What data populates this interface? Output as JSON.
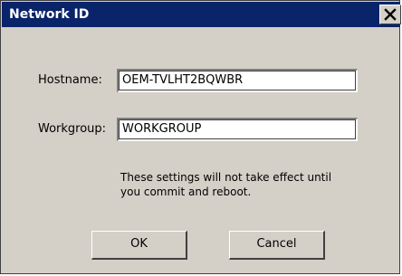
{
  "window": {
    "title": "Network ID",
    "title_bar_color": "#0a246a",
    "face_color": "#d4d0c8",
    "close_icon": "close-icon"
  },
  "form": {
    "hostname_label": "Hostname:",
    "hostname_value": "OEM-TVLHT2BQWBR",
    "workgroup_label": "Workgroup:",
    "workgroup_value": "WORKGROUP"
  },
  "note": {
    "line1": "These settings will not take effect until",
    "line2": "you commit and reboot."
  },
  "buttons": {
    "ok_label": "OK",
    "cancel_label": "Cancel"
  }
}
